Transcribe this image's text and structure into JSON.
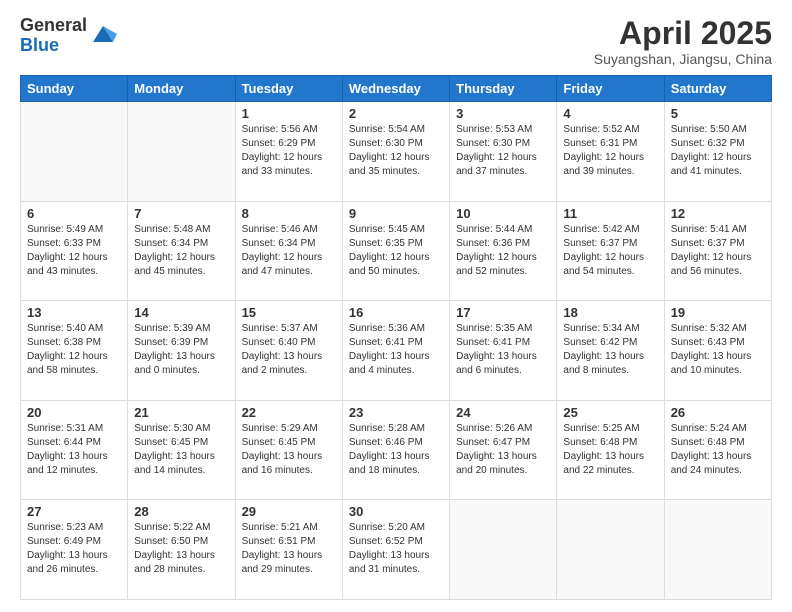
{
  "logo": {
    "general": "General",
    "blue": "Blue"
  },
  "header": {
    "month": "April 2025",
    "location": "Suyangshan, Jiangsu, China"
  },
  "weekdays": [
    "Sunday",
    "Monday",
    "Tuesday",
    "Wednesday",
    "Thursday",
    "Friday",
    "Saturday"
  ],
  "weeks": [
    [
      {
        "day": "",
        "info": ""
      },
      {
        "day": "",
        "info": ""
      },
      {
        "day": "1",
        "info": "Sunrise: 5:56 AM\nSunset: 6:29 PM\nDaylight: 12 hours and 33 minutes."
      },
      {
        "day": "2",
        "info": "Sunrise: 5:54 AM\nSunset: 6:30 PM\nDaylight: 12 hours and 35 minutes."
      },
      {
        "day": "3",
        "info": "Sunrise: 5:53 AM\nSunset: 6:30 PM\nDaylight: 12 hours and 37 minutes."
      },
      {
        "day": "4",
        "info": "Sunrise: 5:52 AM\nSunset: 6:31 PM\nDaylight: 12 hours and 39 minutes."
      },
      {
        "day": "5",
        "info": "Sunrise: 5:50 AM\nSunset: 6:32 PM\nDaylight: 12 hours and 41 minutes."
      }
    ],
    [
      {
        "day": "6",
        "info": "Sunrise: 5:49 AM\nSunset: 6:33 PM\nDaylight: 12 hours and 43 minutes."
      },
      {
        "day": "7",
        "info": "Sunrise: 5:48 AM\nSunset: 6:34 PM\nDaylight: 12 hours and 45 minutes."
      },
      {
        "day": "8",
        "info": "Sunrise: 5:46 AM\nSunset: 6:34 PM\nDaylight: 12 hours and 47 minutes."
      },
      {
        "day": "9",
        "info": "Sunrise: 5:45 AM\nSunset: 6:35 PM\nDaylight: 12 hours and 50 minutes."
      },
      {
        "day": "10",
        "info": "Sunrise: 5:44 AM\nSunset: 6:36 PM\nDaylight: 12 hours and 52 minutes."
      },
      {
        "day": "11",
        "info": "Sunrise: 5:42 AM\nSunset: 6:37 PM\nDaylight: 12 hours and 54 minutes."
      },
      {
        "day": "12",
        "info": "Sunrise: 5:41 AM\nSunset: 6:37 PM\nDaylight: 12 hours and 56 minutes."
      }
    ],
    [
      {
        "day": "13",
        "info": "Sunrise: 5:40 AM\nSunset: 6:38 PM\nDaylight: 12 hours and 58 minutes."
      },
      {
        "day": "14",
        "info": "Sunrise: 5:39 AM\nSunset: 6:39 PM\nDaylight: 13 hours and 0 minutes."
      },
      {
        "day": "15",
        "info": "Sunrise: 5:37 AM\nSunset: 6:40 PM\nDaylight: 13 hours and 2 minutes."
      },
      {
        "day": "16",
        "info": "Sunrise: 5:36 AM\nSunset: 6:41 PM\nDaylight: 13 hours and 4 minutes."
      },
      {
        "day": "17",
        "info": "Sunrise: 5:35 AM\nSunset: 6:41 PM\nDaylight: 13 hours and 6 minutes."
      },
      {
        "day": "18",
        "info": "Sunrise: 5:34 AM\nSunset: 6:42 PM\nDaylight: 13 hours and 8 minutes."
      },
      {
        "day": "19",
        "info": "Sunrise: 5:32 AM\nSunset: 6:43 PM\nDaylight: 13 hours and 10 minutes."
      }
    ],
    [
      {
        "day": "20",
        "info": "Sunrise: 5:31 AM\nSunset: 6:44 PM\nDaylight: 13 hours and 12 minutes."
      },
      {
        "day": "21",
        "info": "Sunrise: 5:30 AM\nSunset: 6:45 PM\nDaylight: 13 hours and 14 minutes."
      },
      {
        "day": "22",
        "info": "Sunrise: 5:29 AM\nSunset: 6:45 PM\nDaylight: 13 hours and 16 minutes."
      },
      {
        "day": "23",
        "info": "Sunrise: 5:28 AM\nSunset: 6:46 PM\nDaylight: 13 hours and 18 minutes."
      },
      {
        "day": "24",
        "info": "Sunrise: 5:26 AM\nSunset: 6:47 PM\nDaylight: 13 hours and 20 minutes."
      },
      {
        "day": "25",
        "info": "Sunrise: 5:25 AM\nSunset: 6:48 PM\nDaylight: 13 hours and 22 minutes."
      },
      {
        "day": "26",
        "info": "Sunrise: 5:24 AM\nSunset: 6:48 PM\nDaylight: 13 hours and 24 minutes."
      }
    ],
    [
      {
        "day": "27",
        "info": "Sunrise: 5:23 AM\nSunset: 6:49 PM\nDaylight: 13 hours and 26 minutes."
      },
      {
        "day": "28",
        "info": "Sunrise: 5:22 AM\nSunset: 6:50 PM\nDaylight: 13 hours and 28 minutes."
      },
      {
        "day": "29",
        "info": "Sunrise: 5:21 AM\nSunset: 6:51 PM\nDaylight: 13 hours and 29 minutes."
      },
      {
        "day": "30",
        "info": "Sunrise: 5:20 AM\nSunset: 6:52 PM\nDaylight: 13 hours and 31 minutes."
      },
      {
        "day": "",
        "info": ""
      },
      {
        "day": "",
        "info": ""
      },
      {
        "day": "",
        "info": ""
      }
    ]
  ]
}
